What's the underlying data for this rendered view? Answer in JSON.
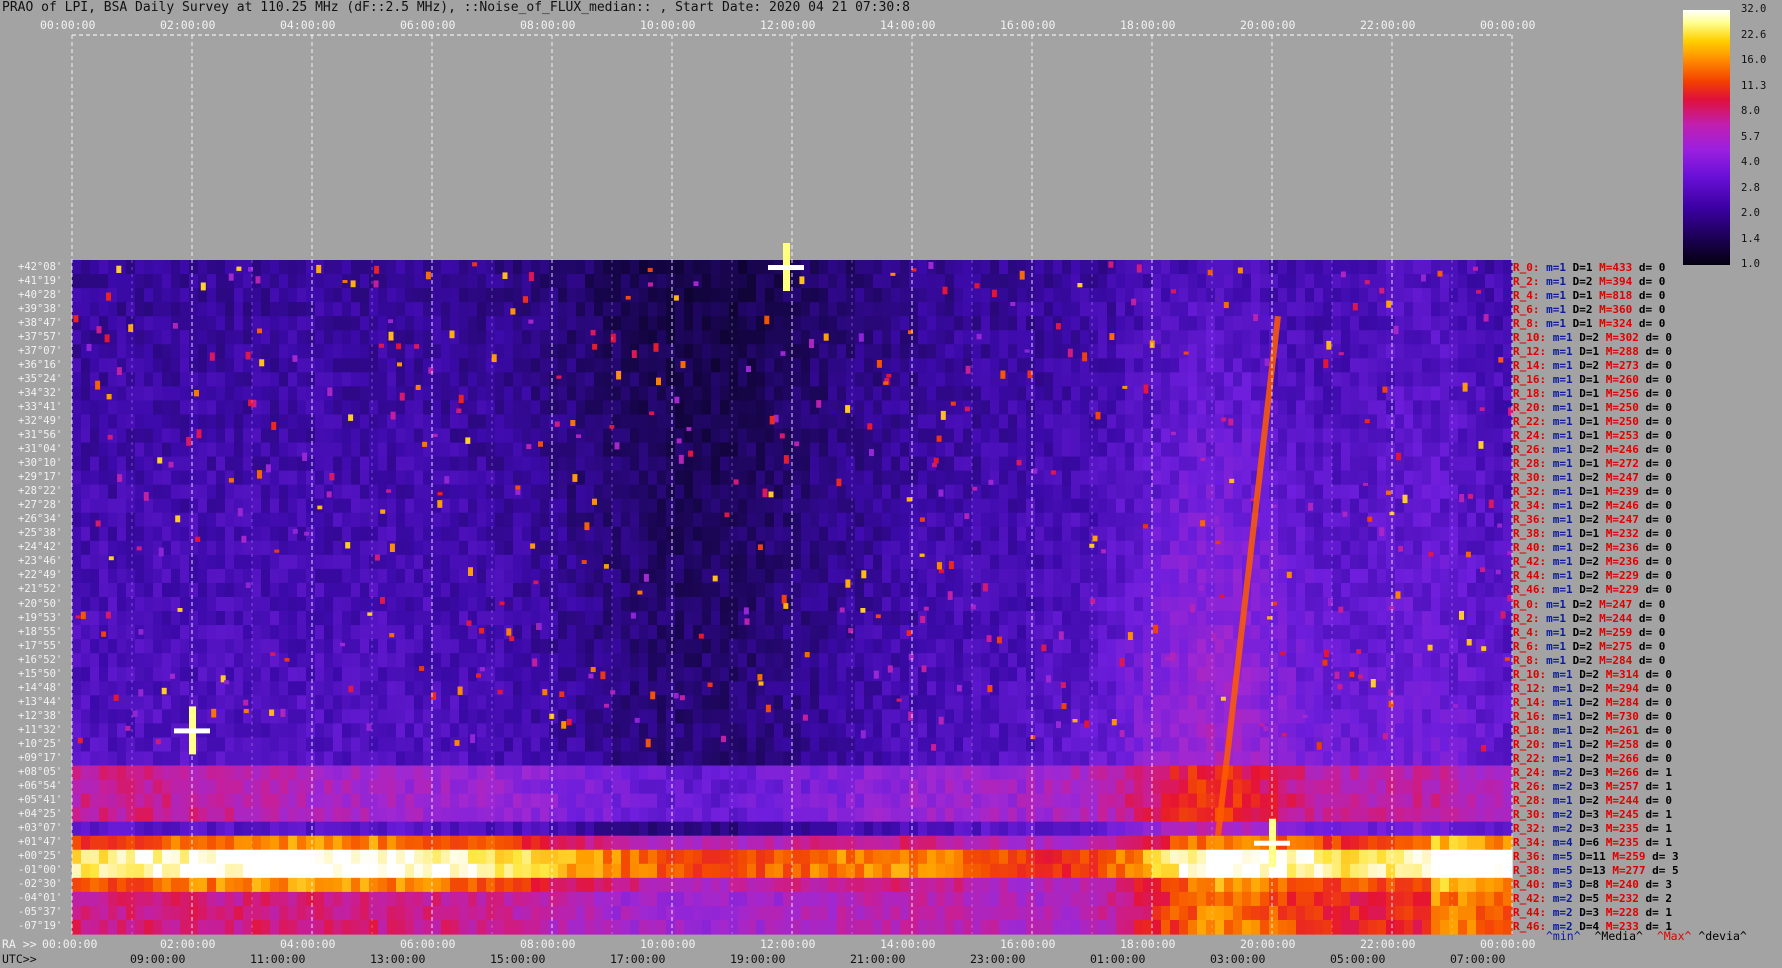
{
  "title": "PRAO of LPI, BSA Daily Survey at 110.25 MHz (dF::2.5 MHz), ::Noise_of_FLUX_median:: , Start Date: 2020 04 21 07:30:8",
  "top_axis_ticks": [
    "00:00:00",
    "02:00:00",
    "04:00:00",
    "06:00:00",
    "08:00:00",
    "10:00:00",
    "12:00:00",
    "14:00:00",
    "16:00:00",
    "18:00:00",
    "20:00:00",
    "22:00:00",
    "00:00:00"
  ],
  "ra_axis_prefix": "RA >>",
  "ra_axis_ticks": [
    "00:00:00",
    "02:00:00",
    "04:00:00",
    "06:00:00",
    "08:00:00",
    "10:00:00",
    "12:00:00",
    "14:00:00",
    "16:00:00",
    "18:00:00",
    "20:00:00",
    "22:00:00",
    "00:00:00"
  ],
  "utc_axis_prefix": "UTC>>",
  "utc_axis_ticks": [
    "09:00:00",
    "11:00:00",
    "13:00:00",
    "15:00:00",
    "17:00:00",
    "19:00:00",
    "21:00:00",
    "23:00:00",
    "01:00:00",
    "03:00:00",
    "05:00:00",
    "07:00:00"
  ],
  "declination_labels": [
    "+42°08'",
    "+41°19'",
    "+40°28'",
    "+39°38'",
    "+38°47'",
    "+37°57'",
    "+37°07'",
    "+36°16'",
    "+35°24'",
    "+34°32'",
    "+33°41'",
    "+32°49'",
    "+31°56'",
    "+31°04'",
    "+30°10'",
    "+29°17'",
    "+28°22'",
    "+27°28'",
    "+26°34'",
    "+25°38'",
    "+24°42'",
    "+23°46'",
    "+22°49'",
    "+21°52'",
    "+20°50'",
    "+19°53'",
    "+18°55'",
    "+17°55'",
    "+16°52'",
    "+15°50'",
    "+14°48'",
    "+13°44'",
    "+12°38'",
    "+11°32'",
    "+10°25'",
    "+09°17'",
    "+08°05'",
    "+06°54'",
    "+05°41'",
    "+04°25'",
    "+03°07'",
    "+01°47'",
    "+00°25'",
    "-01°00'",
    "-02°30'",
    "-04°01'",
    "-05°37'",
    "-07°19'"
  ],
  "color_scale_labels": [
    "32.0",
    "22.6",
    "16.0",
    "11.3",
    "8.0",
    "5.7",
    "4.0",
    "2.8",
    "2.0",
    "1.4",
    "1.0"
  ],
  "stats_rows": [
    {
      "r": "R_0:",
      "m": "m=1",
      "d": "D=1",
      "M": "M=433",
      "dev": "d= 0"
    },
    {
      "r": "R_2:",
      "m": "m=1",
      "d": "D=2",
      "M": "M=394",
      "dev": "d= 0"
    },
    {
      "r": "R_4:",
      "m": "m=1",
      "d": "D=1",
      "M": "M=818",
      "dev": "d= 0"
    },
    {
      "r": "R_6:",
      "m": "m=1",
      "d": "D=2",
      "M": "M=360",
      "dev": "d= 0"
    },
    {
      "r": "R_8:",
      "m": "m=1",
      "d": "D=1",
      "M": "M=324",
      "dev": "d= 0"
    },
    {
      "r": "R_10:",
      "m": "m=1",
      "d": "D=2",
      "M": "M=302",
      "dev": "d= 0"
    },
    {
      "r": "R_12:",
      "m": "m=1",
      "d": "D=1",
      "M": "M=288",
      "dev": "d= 0"
    },
    {
      "r": "R_14:",
      "m": "m=1",
      "d": "D=2",
      "M": "M=273",
      "dev": "d= 0"
    },
    {
      "r": "R_16:",
      "m": "m=1",
      "d": "D=1",
      "M": "M=260",
      "dev": "d= 0"
    },
    {
      "r": "R_18:",
      "m": "m=1",
      "d": "D=1",
      "M": "M=256",
      "dev": "d= 0"
    },
    {
      "r": "R_20:",
      "m": "m=1",
      "d": "D=1",
      "M": "M=250",
      "dev": "d= 0"
    },
    {
      "r": "R_22:",
      "m": "m=1",
      "d": "D=1",
      "M": "M=250",
      "dev": "d= 0"
    },
    {
      "r": "R_24:",
      "m": "m=1",
      "d": "D=1",
      "M": "M=253",
      "dev": "d= 0"
    },
    {
      "r": "R_26:",
      "m": "m=1",
      "d": "D=2",
      "M": "M=246",
      "dev": "d= 0"
    },
    {
      "r": "R_28:",
      "m": "m=1",
      "d": "D=1",
      "M": "M=272",
      "dev": "d= 0"
    },
    {
      "r": "R_30:",
      "m": "m=1",
      "d": "D=2",
      "M": "M=247",
      "dev": "d= 0"
    },
    {
      "r": "R_32:",
      "m": "m=1",
      "d": "D=1",
      "M": "M=239",
      "dev": "d= 0"
    },
    {
      "r": "R_34:",
      "m": "m=1",
      "d": "D=2",
      "M": "M=246",
      "dev": "d= 0"
    },
    {
      "r": "R_36:",
      "m": "m=1",
      "d": "D=2",
      "M": "M=247",
      "dev": "d= 0"
    },
    {
      "r": "R_38:",
      "m": "m=1",
      "d": "D=1",
      "M": "M=232",
      "dev": "d= 0"
    },
    {
      "r": "R_40:",
      "m": "m=1",
      "d": "D=2",
      "M": "M=236",
      "dev": "d= 0"
    },
    {
      "r": "R_42:",
      "m": "m=1",
      "d": "D=2",
      "M": "M=236",
      "dev": "d= 0"
    },
    {
      "r": "R_44:",
      "m": "m=1",
      "d": "D=2",
      "M": "M=229",
      "dev": "d= 0"
    },
    {
      "r": "R_46:",
      "m": "m=1",
      "d": "D=2",
      "M": "M=229",
      "dev": "d= 0"
    },
    {
      "r": "R_0:",
      "m": "m=1",
      "d": "D=2",
      "M": "M=247",
      "dev": "d= 0"
    },
    {
      "r": "R_2:",
      "m": "m=1",
      "d": "D=2",
      "M": "M=244",
      "dev": "d= 0"
    },
    {
      "r": "R_4:",
      "m": "m=1",
      "d": "D=2",
      "M": "M=259",
      "dev": "d= 0"
    },
    {
      "r": "R_6:",
      "m": "m=1",
      "d": "D=2",
      "M": "M=275",
      "dev": "d= 0"
    },
    {
      "r": "R_8:",
      "m": "m=1",
      "d": "D=2",
      "M": "M=284",
      "dev": "d= 0"
    },
    {
      "r": "R_10:",
      "m": "m=1",
      "d": "D=2",
      "M": "M=314",
      "dev": "d= 0"
    },
    {
      "r": "R_12:",
      "m": "m=1",
      "d": "D=2",
      "M": "M=294",
      "dev": "d= 0"
    },
    {
      "r": "R_14:",
      "m": "m=1",
      "d": "D=2",
      "M": "M=284",
      "dev": "d= 0"
    },
    {
      "r": "R_16:",
      "m": "m=1",
      "d": "D=2",
      "M": "M=730",
      "dev": "d= 0"
    },
    {
      "r": "R_18:",
      "m": "m=1",
      "d": "D=2",
      "M": "M=261",
      "dev": "d= 0"
    },
    {
      "r": "R_20:",
      "m": "m=1",
      "d": "D=2",
      "M": "M=258",
      "dev": "d= 0"
    },
    {
      "r": "R_22:",
      "m": "m=1",
      "d": "D=2",
      "M": "M=266",
      "dev": "d= 0"
    },
    {
      "r": "R_24:",
      "m": "m=2",
      "d": "D=3",
      "M": "M=266",
      "dev": "d= 1"
    },
    {
      "r": "R_26:",
      "m": "m=2",
      "d": "D=3",
      "M": "M=257",
      "dev": "d= 1"
    },
    {
      "r": "R_28:",
      "m": "m=1",
      "d": "D=2",
      "M": "M=244",
      "dev": "d= 0"
    },
    {
      "r": "R_30:",
      "m": "m=2",
      "d": "D=3",
      "M": "M=245",
      "dev": "d= 1"
    },
    {
      "r": "R_32:",
      "m": "m=2",
      "d": "D=3",
      "M": "M=235",
      "dev": "d= 1"
    },
    {
      "r": "R_34:",
      "m": "m=4",
      "d": "D=6",
      "M": "M=235",
      "dev": "d= 1"
    },
    {
      "r": "R_36:",
      "m": "m=5",
      "d": "D=11",
      "M": "M=259",
      "dev": "d= 3"
    },
    {
      "r": "R_38:",
      "m": "m=5",
      "d": "D=13",
      "M": "M=277",
      "dev": "d= 5"
    },
    {
      "r": "R_40:",
      "m": "m=3",
      "d": "D=8",
      "M": "M=240",
      "dev": "d= 3"
    },
    {
      "r": "R_42:",
      "m": "m=2",
      "d": "D=5",
      "M": "M=232",
      "dev": "d= 2"
    },
    {
      "r": "R_44:",
      "m": "m=2",
      "d": "D=3",
      "M": "M=228",
      "dev": "d= 1"
    },
    {
      "r": "R_46:",
      "m": "m=2",
      "d": "D=4",
      "M": "M=233",
      "dev": "d= 1"
    }
  ],
  "stats_legend": {
    "min": "^min^",
    "median": "^Media^",
    "max": "^Max^",
    "deviation": "^devia^"
  },
  "chart_data": {
    "type": "heatmap",
    "title": "PRAO of LPI, BSA Daily Survey at 110.25 MHz (dF::2.5 MHz), ::Noise_of_FLUX_median:: , Start Date: 2020 04 21 07:30:8",
    "x_axis_ra_ticks": [
      "00:00:00",
      "02:00:00",
      "04:00:00",
      "06:00:00",
      "08:00:00",
      "10:00:00",
      "12:00:00",
      "14:00:00",
      "16:00:00",
      "18:00:00",
      "20:00:00",
      "22:00:00",
      "00:00:00"
    ],
    "x_axis_utc_ticks": [
      "09:00:00",
      "11:00:00",
      "13:00:00",
      "15:00:00",
      "17:00:00",
      "19:00:00",
      "21:00:00",
      "23:00:00",
      "01:00:00",
      "03:00:00",
      "05:00:00",
      "07:00:00"
    ],
    "y_axis_declinations_count": 48,
    "color_scale": {
      "min": 1.0,
      "max": 32.0,
      "log2_ticks": [
        1.0,
        1.4,
        2.0,
        2.8,
        4.0,
        5.7,
        8.0,
        11.3,
        16.0,
        22.6,
        32.0
      ]
    },
    "grid": true,
    "bright_sources_ra_hours": [
      2.0,
      11.9,
      20.0
    ],
    "notes_visible": "Strong horizontal band near declination +00°25' to -01°00'"
  }
}
